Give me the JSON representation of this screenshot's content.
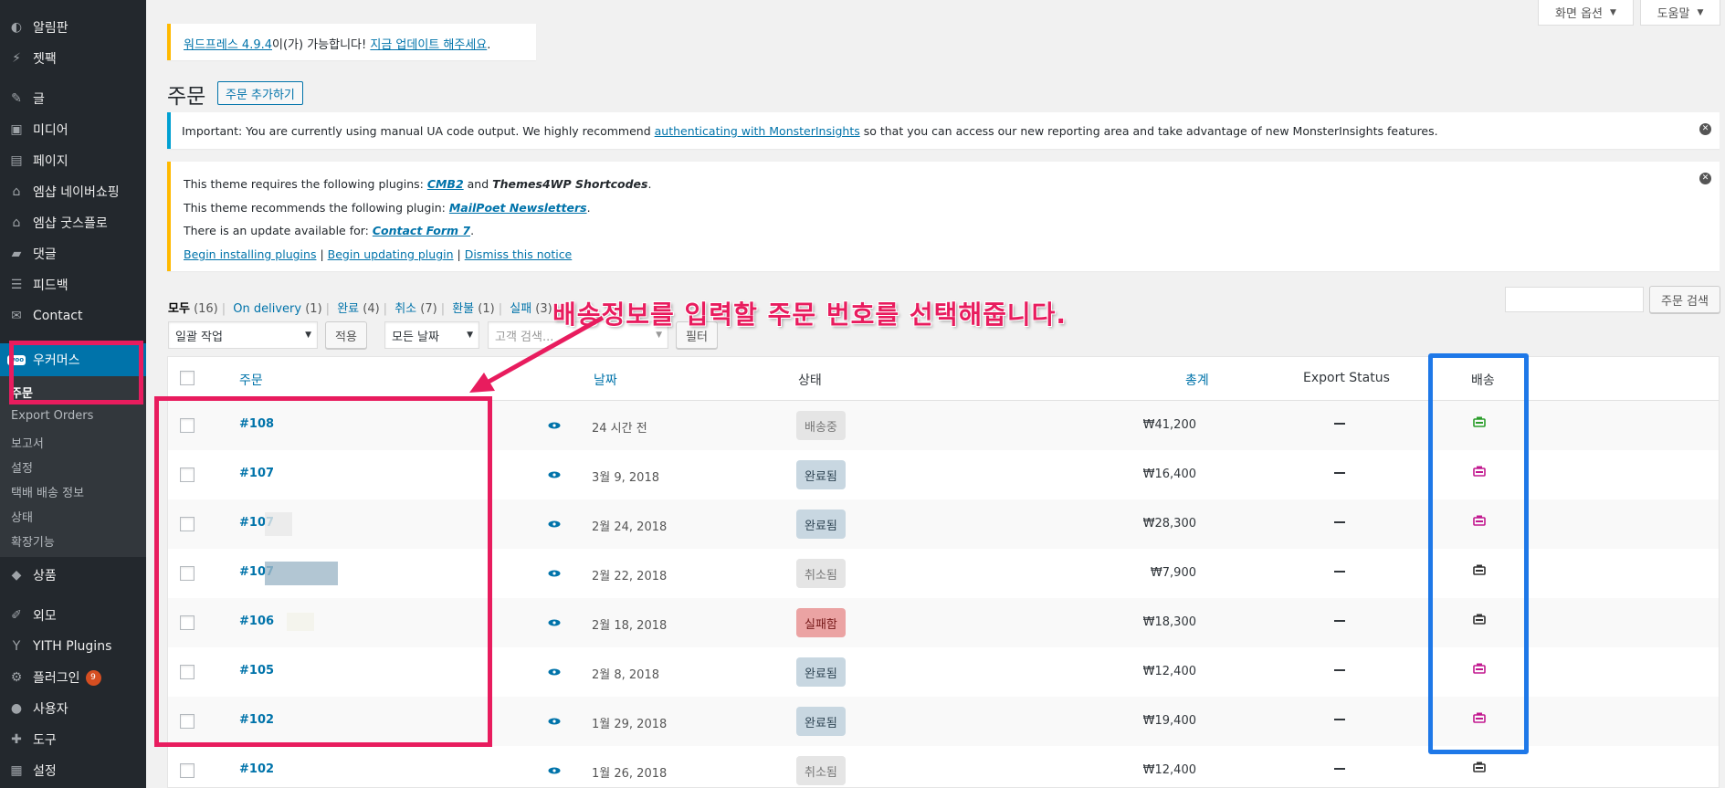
{
  "sidebar": {
    "items": [
      {
        "label": "알림판",
        "icon": "dashboard-icon"
      },
      {
        "label": "젯팩",
        "icon": "jetpack-icon"
      },
      {
        "label": "글",
        "icon": "pin-icon"
      },
      {
        "label": "미디어",
        "icon": "media-icon"
      },
      {
        "label": "페이지",
        "icon": "page-icon"
      },
      {
        "label": "엠샵 네이버쇼핑",
        "icon": "shop-icon"
      },
      {
        "label": "엠샵 굿스플로",
        "icon": "shop-icon"
      },
      {
        "label": "댓글",
        "icon": "comment-icon"
      },
      {
        "label": "피드백",
        "icon": "feedback-icon"
      },
      {
        "label": "Contact",
        "icon": "mail-icon"
      },
      {
        "label": "우커머스",
        "icon": "woo-icon",
        "badge": "woo"
      },
      {
        "label": "상품",
        "icon": "cube-icon"
      },
      {
        "label": "외모",
        "icon": "brush-icon"
      },
      {
        "label": "YITH Plugins",
        "icon": "yith-icon"
      },
      {
        "label": "플러그인",
        "icon": "plugin-icon",
        "count": "9"
      },
      {
        "label": "사용자",
        "icon": "user-icon"
      },
      {
        "label": "도구",
        "icon": "wrench-icon"
      },
      {
        "label": "설정",
        "icon": "settings-icon"
      }
    ],
    "submenu": [
      "주문",
      "Export Orders",
      "보고서",
      "설정",
      "택배 배송 정보",
      "상태",
      "확장기능"
    ]
  },
  "top": {
    "screen_options": "화면 옵션",
    "help": "도움말"
  },
  "update_notice": {
    "link1": "워드프레스 4.9.4",
    "text1": "이(가) 가능합니다!",
    "link2": "지금 업데이트 해주세요",
    "end": "."
  },
  "page": {
    "title": "주문",
    "add_button": "주문 추가하기"
  },
  "monster_notice": {
    "text1": "Important: You are currently using manual UA code output. We highly recommend ",
    "link": "authenticating with MonsterInsights",
    "text2": " so that you can access our new reporting area and take advantage of new MonsterInsights features."
  },
  "plugin_notice": {
    "l1a": "This theme requires the following plugins: ",
    "l1b": "CMB2",
    "l1c": " and ",
    "l1d": "Themes4WP Shortcodes",
    "l1e": ".",
    "l2a": "This theme recommends the following plugin: ",
    "l2b": "MailPoet Newsletters",
    "l2c": ".",
    "l3a": "There is an update available for: ",
    "l3b": "Contact Form 7",
    "l3c": ".",
    "a1": "Begin installing plugins",
    "a2": "Begin updating plugin",
    "a3": "Dismiss this notice",
    "sep": " | "
  },
  "filters": [
    {
      "label": "모두",
      "count": "(16)"
    },
    {
      "label": "On delivery",
      "count": "(1)"
    },
    {
      "label": "완료",
      "count": "(4)"
    },
    {
      "label": "취소",
      "count": "(7)"
    },
    {
      "label": "환불",
      "count": "(1)"
    },
    {
      "label": "실패",
      "count": "(3)"
    }
  ],
  "search_button": "주문 검색",
  "bulk": {
    "select": "일괄 작업",
    "apply": "적용",
    "dates": "모든 날짜",
    "customer": "고객 검색...",
    "filter": "필터"
  },
  "table": {
    "columns": {
      "order": "주문",
      "date": "날짜",
      "status": "상태",
      "total": "총계",
      "export": "Export Status",
      "shipping": "배송"
    },
    "rows": [
      {
        "order": "#108",
        "date": "24 시간 전",
        "status": "배송중",
        "status_type": "shipping",
        "total": "₩41,200",
        "ship_color": "#2a9d2a"
      },
      {
        "order": "#107",
        "date": "3월 9, 2018",
        "status": "완료됨",
        "status_type": "completed",
        "total": "₩16,400",
        "ship_color": "#c2188f"
      },
      {
        "order": "#107",
        "date": "2월 24, 2018",
        "status": "완료됨",
        "status_type": "completed",
        "total": "₩28,300",
        "ship_color": "#c2188f"
      },
      {
        "order": "#107",
        "date": "2월 22, 2018",
        "status": "취소됨",
        "status_type": "cancelled",
        "total": "₩7,900",
        "ship_color": "#333333"
      },
      {
        "order": "#106",
        "date": "2월 18, 2018",
        "status": "실패함",
        "status_type": "failed",
        "total": "₩18,300",
        "ship_color": "#333333"
      },
      {
        "order": "#105",
        "date": "2월 8, 2018",
        "status": "완료됨",
        "status_type": "completed",
        "total": "₩12,400",
        "ship_color": "#c2188f"
      },
      {
        "order": "#102",
        "date": "1월 29, 2018",
        "status": "완료됨",
        "status_type": "completed",
        "total": "₩19,400",
        "ship_color": "#c2188f"
      },
      {
        "order": "#102",
        "date": "1월 26, 2018",
        "status": "취소됨",
        "status_type": "cancelled",
        "total": "₩12,400",
        "ship_color": "#333333"
      }
    ]
  },
  "annotation": {
    "text": "배송정보를 입력할 주문 번호를 선택해줍니다.",
    "color": "#e81c5e",
    "blue": "#1e78e8"
  }
}
